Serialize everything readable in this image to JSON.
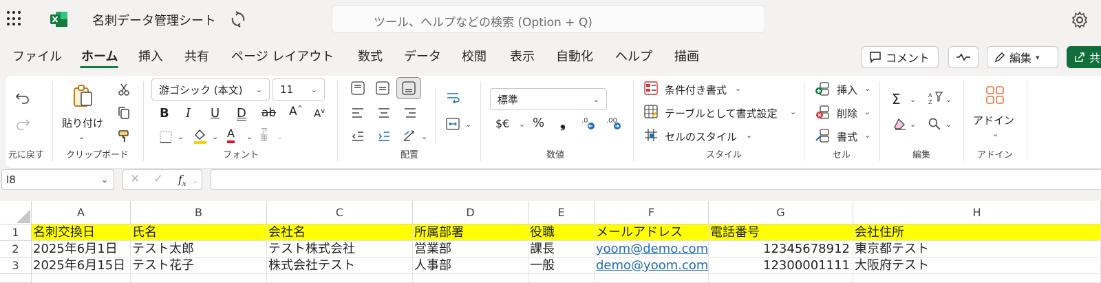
{
  "title_bar": {
    "doc_title": "名刺データ管理シート",
    "search_placeholder": "ツール、ヘルプなどの検索 (Option + Q)"
  },
  "tabs": [
    {
      "label": "ファイル"
    },
    {
      "label": "ホーム",
      "active": true
    },
    {
      "label": "挿入"
    },
    {
      "label": "共有"
    },
    {
      "label": "ページ レイアウト"
    },
    {
      "label": "数式"
    },
    {
      "label": "データ"
    },
    {
      "label": "校閲"
    },
    {
      "label": "表示"
    },
    {
      "label": "自動化"
    },
    {
      "label": "ヘルプ"
    },
    {
      "label": "描画"
    }
  ],
  "toolbar_right": {
    "comment_label": "コメント",
    "edit_label": "編集",
    "share_label": "共"
  },
  "ribbon": {
    "undo_group": "元に戻す",
    "clipboard": {
      "paste_label": "貼り付け",
      "group": "クリップボード"
    },
    "font": {
      "family": "游ゴシック (本文)",
      "size": "11",
      "group": "フォント"
    },
    "alignment": {
      "group": "配置"
    },
    "number": {
      "format": "標準",
      "currency": "$€",
      "group": "数値"
    },
    "styles": {
      "conditional": "条件付き書式",
      "as_table": "テーブルとして書式設定",
      "cell_styles": "セルのスタイル",
      "group": "スタイル"
    },
    "cells": {
      "insert": "挿入",
      "delete": "削除",
      "format": "書式",
      "group": "セル"
    },
    "editing": {
      "group": "編集"
    },
    "addins": {
      "label": "アドイン",
      "group": "アドイン"
    }
  },
  "formula_bar": {
    "name_box": "I8",
    "formula": ""
  },
  "sheet": {
    "columns": [
      "A",
      "B",
      "C",
      "D",
      "E",
      "F",
      "G",
      "H"
    ],
    "row_numbers": [
      "1",
      "2",
      "3"
    ],
    "rows": [
      [
        "名刺交換日",
        "氏名",
        "会社名",
        "所属部署",
        "役職",
        "メールアドレス",
        "電話番号",
        "会社住所"
      ],
      [
        "2025年6月1日",
        "テスト太郎",
        "テスト株式会社",
        "営業部",
        "課長",
        "yoom@demo.com",
        "12345678912",
        "東京都テスト"
      ],
      [
        "2025年6月15日",
        "テスト花子",
        "株式会社テスト",
        "人事部",
        "一般",
        "demo@yoom.com",
        "12300001111",
        "大阪府テスト"
      ]
    ]
  },
  "colors": {
    "accent_green": "#107c41",
    "header_row_fill": "#ffff00",
    "link": "#1f6bb8"
  }
}
